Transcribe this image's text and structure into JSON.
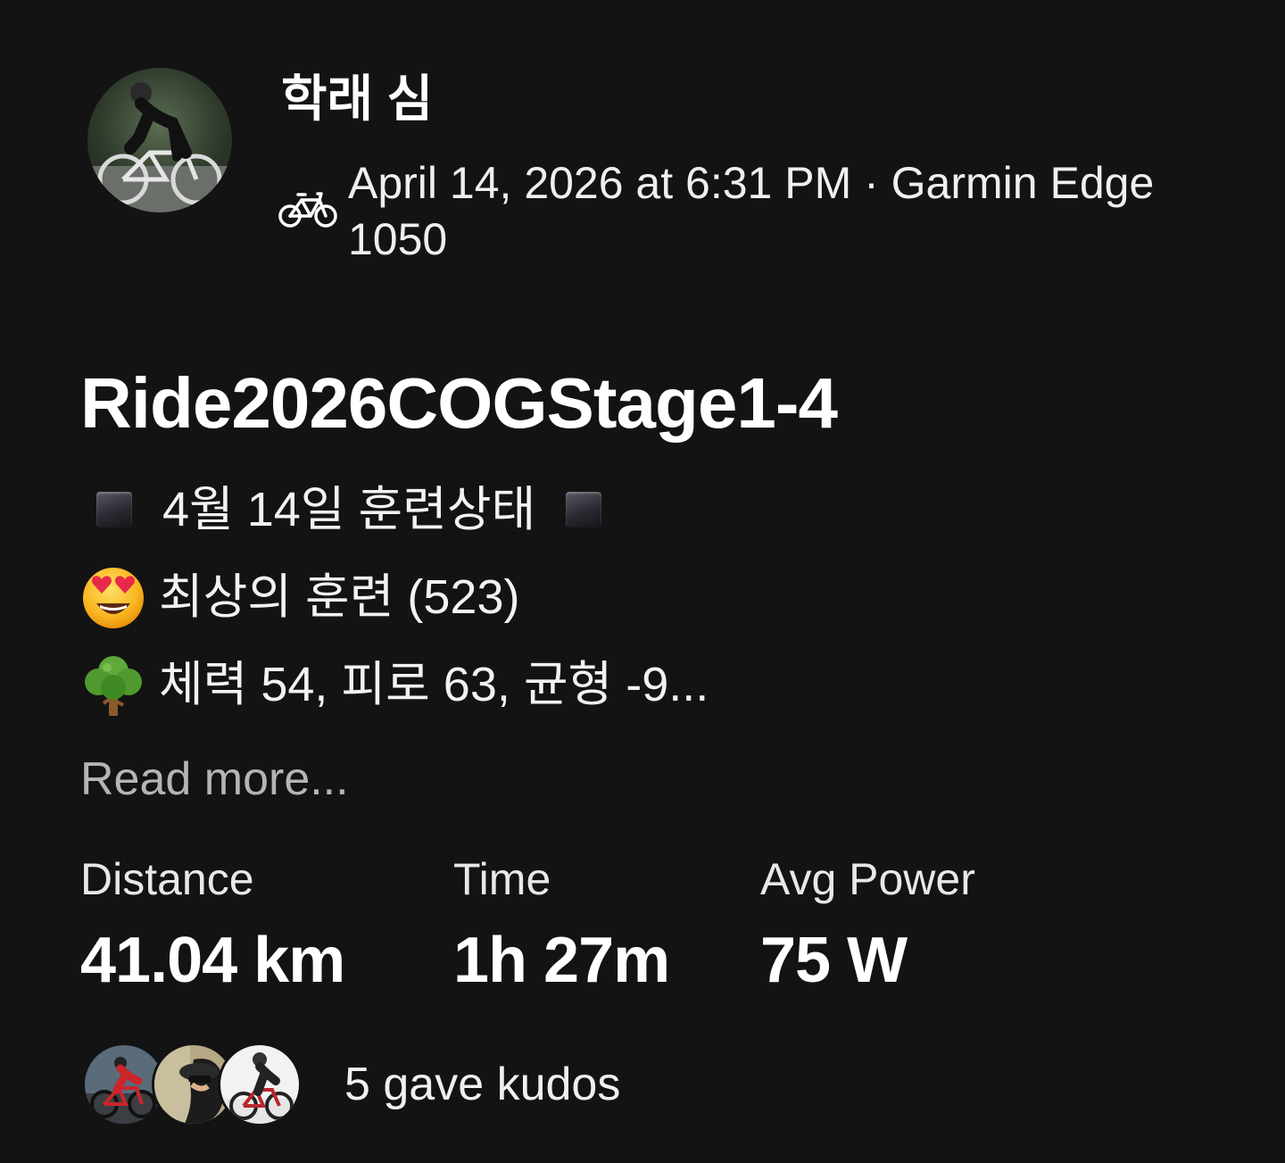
{
  "athlete": {
    "name": "학래 심",
    "avatar_icon": "cyclist-photo"
  },
  "activity": {
    "sport_icon": "bike-icon",
    "meta": "April 14, 2026 at 6:31 PM · Garmin Edge 1050",
    "title": "Ride2026COGStage1-4"
  },
  "description": {
    "line1_text": "4월 14일 훈련상태",
    "line1_icon": "black-square-icon",
    "line2_text": "최상의 훈련 (523)",
    "line2_icon": "heart-eyes-emoji-icon",
    "line3_text": "체력 54, 피로 63, 균형 -9...",
    "line3_icon": "tree-emoji-icon",
    "read_more": "Read more..."
  },
  "stats": [
    {
      "label": "Distance",
      "value": "41.04 km"
    },
    {
      "label": "Time",
      "value": "1h 27m"
    },
    {
      "label": "Avg Power",
      "value": "75 W"
    }
  ],
  "kudos": {
    "text": "5 gave kudos",
    "avatars": [
      "kudos-avatar-1",
      "kudos-avatar-2",
      "kudos-avatar-3"
    ]
  }
}
